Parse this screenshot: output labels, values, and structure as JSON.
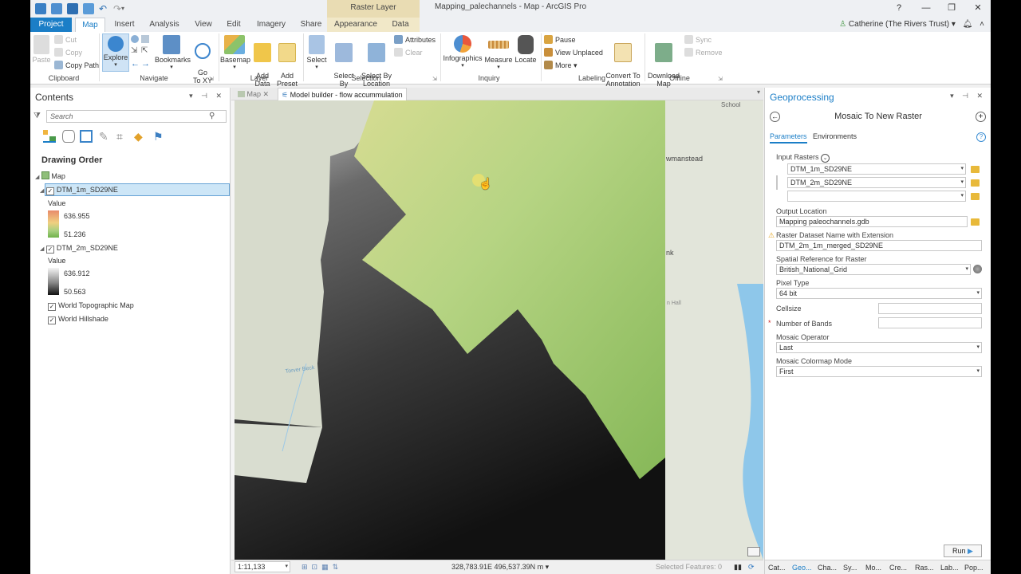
{
  "title_bar": {
    "contextual_tab_group": "Raster Layer",
    "app_title": "Mapping_palechannels - Map - ArcGIS Pro",
    "help": "?",
    "minimize": "—",
    "restore": "❐",
    "close": "✕"
  },
  "tabs": [
    "Project",
    "Map",
    "Insert",
    "Analysis",
    "View",
    "Edit",
    "Imagery",
    "Share",
    "Appearance",
    "Data"
  ],
  "user": "Catherine (The Rivers Trust)",
  "ribbon": {
    "clipboard": {
      "paste": "Paste",
      "cut": "Cut",
      "copy": "Copy",
      "copy_path": "Copy Path",
      "label": "Clipboard"
    },
    "navigate": {
      "explore": "Explore",
      "bookmarks": "Bookmarks",
      "go_to_xy": "Go\nTo XY",
      "label": "Navigate"
    },
    "layer": {
      "basemap": "Basemap",
      "add_data": "Add\nData",
      "add_preset": "Add\nPreset",
      "label": "Layer"
    },
    "selection": {
      "select": "Select",
      "select_by_attributes": "Select By\nAttributes",
      "select_by_location": "Select By\nLocation",
      "attributes": "Attributes",
      "clear": "Clear",
      "label": "Selection"
    },
    "inquiry": {
      "infographics": "Infographics",
      "measure": "Measure",
      "locate": "Locate",
      "label": "Inquiry"
    },
    "labeling": {
      "pause": "Pause",
      "view_unplaced": "View Unplaced",
      "more": "More",
      "convert": "Convert To\nAnnotation",
      "label": "Labeling"
    },
    "offline": {
      "download_map": "Download\nMap",
      "sync": "Sync",
      "remove": "Remove",
      "label": "Offline"
    }
  },
  "contents": {
    "title": "Contents",
    "search_placeholder": "Search",
    "drawing_order": "Drawing Order",
    "map": "Map",
    "layers": [
      {
        "name": "DTM_1m_SD29NE",
        "value_label": "Value",
        "high": "636.955",
        "low": "51.236"
      },
      {
        "name": "DTM_2m_SD29NE",
        "value_label": "Value",
        "high": "636.912",
        "low": "50.563"
      }
    ],
    "basemaps": [
      "World Topographic Map",
      "World Hillshade"
    ]
  },
  "map_view": {
    "tabs": [
      "Map",
      "Model builder - flow accummulation"
    ],
    "labels": {
      "school": "School",
      "village": "wmanstead",
      "partial": "nk",
      "hall": "n Hall",
      "beck": "Torver Beck"
    },
    "scale": "1:11,133",
    "coordinates": "328,783.91E 496,537.39N m",
    "selected_features": "Selected Features: 0"
  },
  "geoprocessing": {
    "title": "Geoprocessing",
    "tool_title": "Mosaic To New Raster",
    "tabs": [
      "Parameters",
      "Environments"
    ],
    "input_rasters_label": "Input Rasters",
    "input_rasters": [
      "DTM_1m_SD29NE",
      "DTM_2m_SD29NE",
      ""
    ],
    "output_location_label": "Output Location",
    "output_location": "Mapping paleochannels.gdb",
    "dataset_name_label": "Raster Dataset Name with Extension",
    "dataset_name": "DTM_2m_1m_merged_SD29NE",
    "spatial_ref_label": "Spatial Reference for Raster",
    "spatial_ref": "British_National_Grid",
    "pixel_type_label": "Pixel Type",
    "pixel_type": "64 bit",
    "cellsize_label": "Cellsize",
    "cellsize": "",
    "num_bands_label": "Number of Bands",
    "num_bands": "",
    "mosaic_operator_label": "Mosaic Operator",
    "mosaic_operator": "Last",
    "colormap_mode_label": "Mosaic Colormap Mode",
    "colormap_mode": "First",
    "run": "Run"
  },
  "bottom_tabs": [
    "Cat...",
    "Geo...",
    "Cha...",
    "Sy...",
    "Mo...",
    "Cre...",
    "Ras...",
    "Lab...",
    "Pop..."
  ]
}
